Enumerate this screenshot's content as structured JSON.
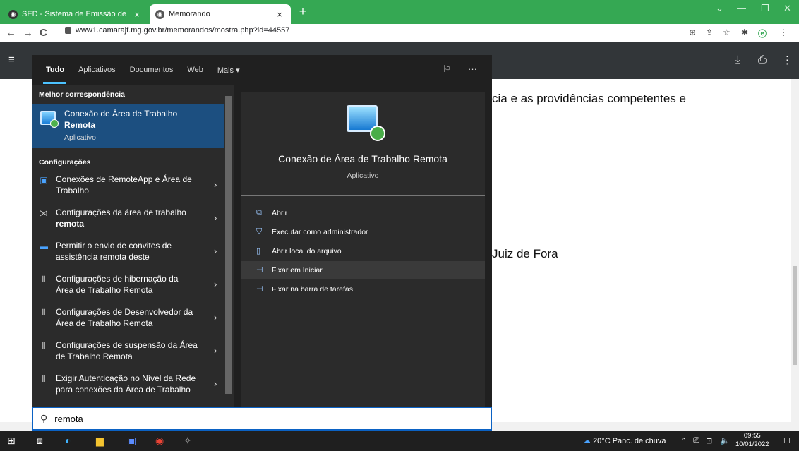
{
  "browser": {
    "tabs": [
      {
        "title": "SED - Sistema de Emissão de Do",
        "close": "×"
      },
      {
        "title": "Memorando",
        "close": "×"
      }
    ],
    "new_tab": "+",
    "url": "www1.camarajf.mg.gov.br/memorandos/mostra.php?id=44557"
  },
  "document": {
    "line1": "cia e as providências competentes e",
    "line2": "Juiz de Fora"
  },
  "search_menu": {
    "tabs": [
      "Tudo",
      "Aplicativos",
      "Documentos",
      "Web",
      "Mais ▾"
    ],
    "best_match_header": "Melhor correspondência",
    "best_match": {
      "name_line1": "Conexão de Área de Trabalho",
      "name_line2": "Remota",
      "type": "Aplicativo"
    },
    "settings_header": "Configurações",
    "settings": [
      {
        "line1": "Conexões de RemoteApp e Área de",
        "line2": "Trabalho"
      },
      {
        "line1": "Configurações da área de trabalho",
        "line2": "remota"
      },
      {
        "line1": "Permitir o envio de convites de",
        "line2": "assistência remota deste"
      },
      {
        "line1": "Configurações de hibernação da",
        "line2": "Área de Trabalho Remota"
      },
      {
        "line1": "Configurações de Desenvolvedor da",
        "line2": "Área de Trabalho Remota"
      },
      {
        "line1": "Configurações de suspensão da Área",
        "line2": "de Trabalho Remota"
      },
      {
        "line1": "Exigir Autenticação no Nível da Rede",
        "line2": "para conexões da Área de Trabalho"
      }
    ],
    "detail": {
      "title": "Conexão de Área de Trabalho Remota",
      "type": "Aplicativo",
      "actions": [
        "Abrir",
        "Executar como administrador",
        "Abrir local do arquivo",
        "Fixar em Iniciar",
        "Fixar na barra de tarefas"
      ]
    },
    "query": "remota"
  },
  "taskbar": {
    "weather": "20°C  Panc. de chuva",
    "time": "09:55",
    "date": "10/01/2022"
  }
}
